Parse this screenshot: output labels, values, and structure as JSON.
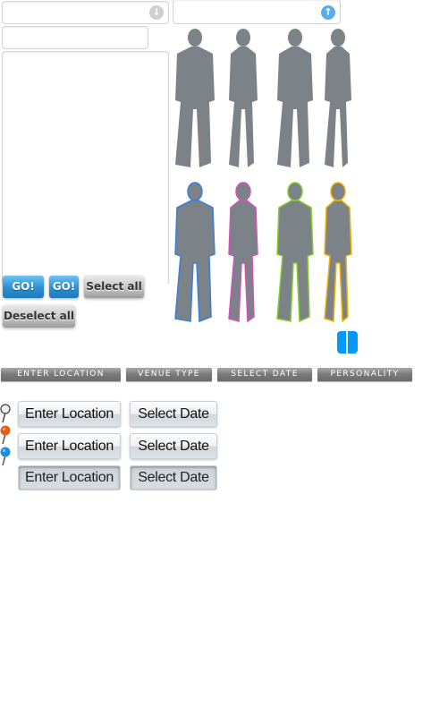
{
  "fields": {
    "dropdown_down_icon": "arrow-down-circle-icon",
    "dropdown_up_icon": "arrow-up-circle-icon"
  },
  "buttons": {
    "go_primary": "GO!",
    "go_secondary": "GO!",
    "select_all": "Select all",
    "deselect_all": "Deselect all"
  },
  "figures": {
    "outline_colors": [
      "#3b7fd6",
      "#d052b8",
      "#86cc2a",
      "#f0b400"
    ],
    "fill_color": "#7b8288"
  },
  "tabs": [
    "ENTER LOCATION",
    "VENUE TYPE",
    "SELECT DATE",
    "PERSONALITY"
  ],
  "pins": [
    {
      "icon": "pin-gray-icon",
      "color": "#e8e8e8"
    },
    {
      "icon": "pin-orange-icon",
      "color": "#e0601a"
    },
    {
      "icon": "pin-blue-icon",
      "color": "#1a8fe0"
    }
  ],
  "rows": [
    {
      "location": "Enter Location",
      "date": "Select Date",
      "state": "normal"
    },
    {
      "location": "Enter Location",
      "date": "Select Date",
      "state": "hover"
    },
    {
      "location": "Enter Location",
      "date": "Select Date",
      "state": "pressed"
    }
  ],
  "colors": {
    "accent_blue": "#0099ff",
    "up_icon": "#5aaee8",
    "down_icon": "#cfcfcf"
  }
}
